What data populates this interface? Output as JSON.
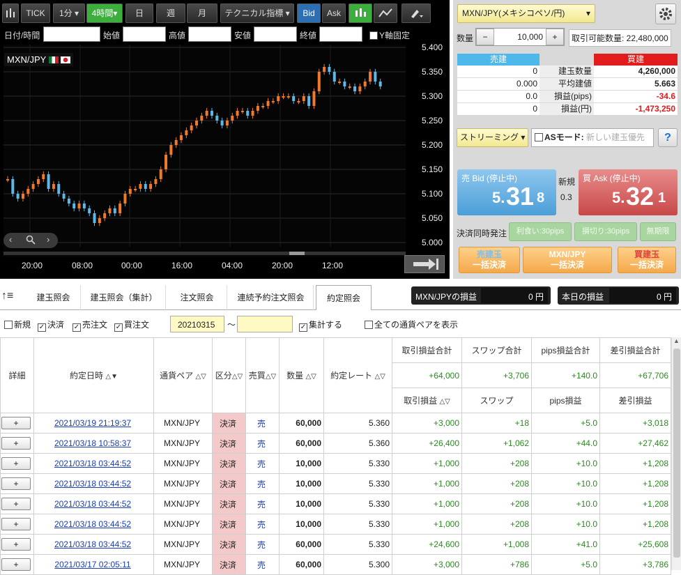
{
  "chart_toolbar": {
    "tick": "TICK",
    "minute": "1分",
    "interval": "4時間",
    "day": "日",
    "week": "週",
    "month": "月",
    "indicator": "テクニカル指標",
    "bid": "Bid",
    "ask": "Ask"
  },
  "chart_fields": {
    "datetime": "日付/時間",
    "open": "始値",
    "high": "高値",
    "low": "安値",
    "close": "終値",
    "y_fixed": "Y軸固定"
  },
  "chart_pair": "MXN/JPY",
  "chart_data": {
    "type": "candlestick",
    "y_ticks": [
      "5.400",
      "5.350",
      "5.300",
      "5.250",
      "5.200",
      "5.150",
      "5.100",
      "5.050",
      "5.000"
    ],
    "x_ticks": [
      "20:00",
      "08:00",
      "00:00",
      "16:00",
      "04:00",
      "20:00",
      "12:00"
    ],
    "ylim": [
      5.0,
      5.4
    ]
  },
  "order": {
    "pair_select": "MXN/JPY(メキシコペソ/円)",
    "qty_label": "数量",
    "qty_value": "10,000",
    "minus": "−",
    "plus": "+",
    "available": "取引可能数量: 22,480,000",
    "sell_header": "売建",
    "buy_header": "買建",
    "rows": [
      {
        "label": "建玉数量",
        "sell": "0",
        "buy": "4,260,000"
      },
      {
        "label": "平均建値",
        "sell": "0.000",
        "buy": "5.663"
      },
      {
        "label": "損益(pips)",
        "sell": "0.0",
        "buy": "-34.6"
      },
      {
        "label": "損益(円)",
        "sell": "0",
        "buy": "-1,473,250"
      }
    ],
    "streaming": "ストリーミング",
    "as_mode": "ASモード:",
    "as_placeholder": "新しい建玉優先",
    "help": "?",
    "bid_label": "売 Bid (停止中)",
    "bid_prefix": "5.",
    "bid_big": "31",
    "bid_suffix": "8",
    "ask_label": "買 Ask (停止中)",
    "ask_prefix": "5.",
    "ask_big": "32",
    "ask_suffix": "1",
    "new_label": "新規",
    "spread": "0.3",
    "settle_label": "決済同時発注",
    "profit_btn": "利食い:30pips",
    "loss_btn": "損切り:30pips",
    "unlimited_btn": "無期限",
    "sell_close": [
      "売建玉",
      "一括決済"
    ],
    "pair_close": [
      "MXN/JPY",
      "一括決済"
    ],
    "buy_close": [
      "買建玉",
      "一括決済"
    ]
  },
  "tabs": [
    "建玉照会",
    "建玉照会（集計）",
    "注文照会",
    "連続予約注文照会",
    "約定照会"
  ],
  "pnl": {
    "pair_label": "MXN/JPYの損益",
    "pair_value": "0 円",
    "today_label": "本日の損益",
    "today_value": "0 円"
  },
  "filters": {
    "new": "新規",
    "settle": "決済",
    "sell_order": "売注文",
    "buy_order": "買注文",
    "date_from": "20210315",
    "tilde": "〜",
    "aggregate": "集計する",
    "all_pairs": "全ての通貨ペアを表示"
  },
  "table": {
    "headers": {
      "detail": "詳細",
      "datetime": "約定日時",
      "pair": "通貨ペア",
      "type": "区分",
      "side": "売買",
      "qty": "数量",
      "rate": "約定レート",
      "pnl_total": "取引損益合計",
      "swap_total": "スワップ合計",
      "pips_total": "pips損益合計",
      "net_total": "差引損益合計",
      "pnl": "取引損益",
      "swap": "スワップ",
      "pips": "pips損益",
      "net": "差引損益"
    },
    "totals": {
      "pnl": "+64,000",
      "swap": "+3,706",
      "pips": "+140.0",
      "net": "+67,706"
    },
    "rows": [
      {
        "btn": "+",
        "datetime": "2021/03/19 21:19:37",
        "pair": "MXN/JPY",
        "type": "決済",
        "side": "売",
        "qty": "60,000",
        "rate": "5.360",
        "pnl": "+3,000",
        "swap": "+18",
        "pips": "+5.0",
        "net": "+3,018"
      },
      {
        "btn": "+",
        "datetime": "2021/03/18 10:58:37",
        "pair": "MXN/JPY",
        "type": "決済",
        "side": "売",
        "qty": "60,000",
        "rate": "5.360",
        "pnl": "+26,400",
        "swap": "+1,062",
        "pips": "+44.0",
        "net": "+27,462"
      },
      {
        "btn": "+",
        "datetime": "2021/03/18 03:44:52",
        "pair": "MXN/JPY",
        "type": "決済",
        "side": "売",
        "qty": "10,000",
        "rate": "5.330",
        "pnl": "+1,000",
        "swap": "+208",
        "pips": "+10.0",
        "net": "+1,208"
      },
      {
        "btn": "+",
        "datetime": "2021/03/18 03:44:52",
        "pair": "MXN/JPY",
        "type": "決済",
        "side": "売",
        "qty": "10,000",
        "rate": "5.330",
        "pnl": "+1,000",
        "swap": "+208",
        "pips": "+10.0",
        "net": "+1,208"
      },
      {
        "btn": "+",
        "datetime": "2021/03/18 03:44:52",
        "pair": "MXN/JPY",
        "type": "決済",
        "side": "売",
        "qty": "10,000",
        "rate": "5.330",
        "pnl": "+1,000",
        "swap": "+208",
        "pips": "+10.0",
        "net": "+1,208"
      },
      {
        "btn": "+",
        "datetime": "2021/03/18 03:44:52",
        "pair": "MXN/JPY",
        "type": "決済",
        "side": "売",
        "qty": "10,000",
        "rate": "5.330",
        "pnl": "+1,000",
        "swap": "+208",
        "pips": "+10.0",
        "net": "+1,208"
      },
      {
        "btn": "+",
        "datetime": "2021/03/18 03:44:52",
        "pair": "MXN/JPY",
        "type": "決済",
        "side": "売",
        "qty": "60,000",
        "rate": "5.330",
        "pnl": "+24,600",
        "swap": "+1,008",
        "pips": "+41.0",
        "net": "+25,608"
      },
      {
        "btn": "+",
        "datetime": "2021/03/17 02:05:11",
        "pair": "MXN/JPY",
        "type": "決済",
        "side": "売",
        "qty": "60,000",
        "rate": "5.300",
        "pnl": "+3,000",
        "swap": "+786",
        "pips": "+5.0",
        "net": "+3,786"
      }
    ]
  }
}
